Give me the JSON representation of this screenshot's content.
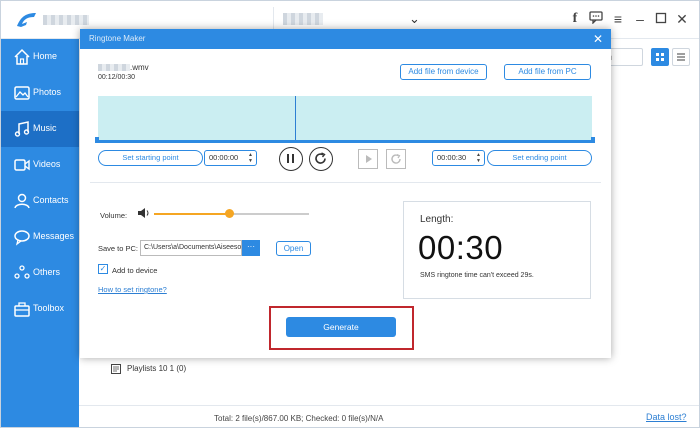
{
  "colors": {
    "accent": "#2d8ae2",
    "sidebar_active": "#1d6fc6",
    "slider": "#f5a623",
    "waveform": "#cbeef2",
    "highlight": "#c0272d"
  },
  "sidebar": {
    "items": [
      {
        "label": "Home",
        "icon": "home-icon"
      },
      {
        "label": "Photos",
        "icon": "photo-icon"
      },
      {
        "label": "Music",
        "icon": "music-icon",
        "active": true
      },
      {
        "label": "Videos",
        "icon": "video-icon"
      },
      {
        "label": "Contacts",
        "icon": "contacts-icon"
      },
      {
        "label": "Messages",
        "icon": "messages-icon"
      },
      {
        "label": "Others",
        "icon": "others-icon"
      },
      {
        "label": "Toolbox",
        "icon": "toolbox-icon"
      }
    ]
  },
  "search": {
    "placeholder": "ch"
  },
  "playlist": {
    "label": "Playlists 10 1 (0)"
  },
  "footer": {
    "total": "Total: 2 file(s)/867.00 KB; Checked: 0 file(s)/N/A",
    "data_lost": "Data lost?"
  },
  "dialog": {
    "title": "Ringtone Maker",
    "close": "✕",
    "file_ext": ".wmv",
    "file_time": "00:12/00:30",
    "add_from_device": "Add file from device",
    "add_from_pc": "Add file from PC",
    "set_start": "Set starting point",
    "start_time": "00:00:00",
    "set_end": "Set ending point",
    "end_time": "00:00:30",
    "volume_label": "Volume:",
    "volume_level": 0.49,
    "save_label": "Save to PC:",
    "save_path": "C:\\Users\\a\\Documents\\Aiseesoft",
    "more": "···",
    "open": "Open",
    "add_to_device": "Add to device",
    "add_to_device_checked": true,
    "how_to": "How to set ringtone?",
    "length_title": "Length:",
    "length_value": "00:30",
    "length_note": "SMS ringtone time can't exceed 29s.",
    "generate": "Generate"
  }
}
